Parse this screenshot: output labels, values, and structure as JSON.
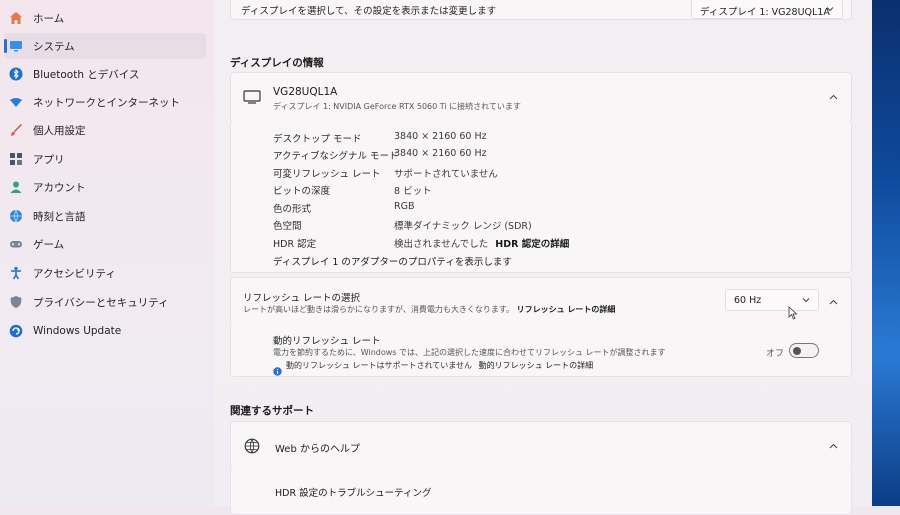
{
  "sidebar": {
    "items": [
      {
        "label": "ホーム",
        "icon": "home-icon"
      },
      {
        "label": "システム",
        "icon": "system-icon"
      },
      {
        "label": "Bluetooth とデバイス",
        "icon": "bluetooth-icon"
      },
      {
        "label": "ネットワークとインターネット",
        "icon": "network-icon"
      },
      {
        "label": "個人用設定",
        "icon": "brush-icon"
      },
      {
        "label": "アプリ",
        "icon": "apps-icon"
      },
      {
        "label": "アカウント",
        "icon": "account-icon"
      },
      {
        "label": "時刻と言語",
        "icon": "globe-clock-icon"
      },
      {
        "label": "ゲーム",
        "icon": "gamepad-icon"
      },
      {
        "label": "アクセシビリティ",
        "icon": "accessibility-icon"
      },
      {
        "label": "プライバシーとセキュリティ",
        "icon": "shield-icon"
      },
      {
        "label": "Windows Update",
        "icon": "update-icon"
      }
    ],
    "active_index": 1
  },
  "top_row": {
    "description": "ディスプレイを選択して、その設定を表示または変更します",
    "display_select": "ディスプレイ 1: VG28UQL1A"
  },
  "display_info": {
    "section_title": "ディスプレイの情報",
    "monitor_name": "VG28UQL1A",
    "monitor_sub": "ディスプレイ 1: NVIDIA GeForce RTX 5060 Ti に接続されています",
    "properties": [
      {
        "label": "デスクトップ モード",
        "value": "3840 × 2160 60 Hz"
      },
      {
        "label": "アクティブなシグナル モード",
        "value": "3840 × 2160 60 Hz"
      },
      {
        "label": "可変リフレッシュ レート",
        "value": "サポートされていません"
      },
      {
        "label": "ビットの深度",
        "value": "8 ビット"
      },
      {
        "label": "色の形式",
        "value": "RGB"
      },
      {
        "label": "色空間",
        "value": "標準ダイナミック レンジ (SDR)"
      },
      {
        "label": "HDR 認定",
        "value": "検出されませんでした",
        "link": "HDR 認定の詳細"
      }
    ],
    "adapter_link": "ディスプレイ 1 のアダプターのプロパティを表示します"
  },
  "refresh": {
    "title": "リフレッシュ レートの選択",
    "desc": "レートが高いほど動きは滑らかになりますが、消費電力も大きくなります。",
    "desc_link": "リフレッシュ レートの詳細",
    "value": "60 Hz"
  },
  "dynamic_refresh": {
    "title": "動的リフレッシュ レート",
    "desc": "電力を節約するために、Windows では、上記の選択した速度に合わせてリフレッシュ レートが調整されます",
    "info": "動的リフレッシュ レートはサポートされていません",
    "info_link": "動的リフレッシュ レートの詳細",
    "toggle_label": "オフ",
    "toggle_on": false
  },
  "related": {
    "section_title": "関連するサポート",
    "web_help": "Web からのヘルプ",
    "item1": "HDR 設定のトラブルシューティング"
  },
  "colors": {
    "accent": "#2a6fc9",
    "link": "#1a1a1a"
  }
}
